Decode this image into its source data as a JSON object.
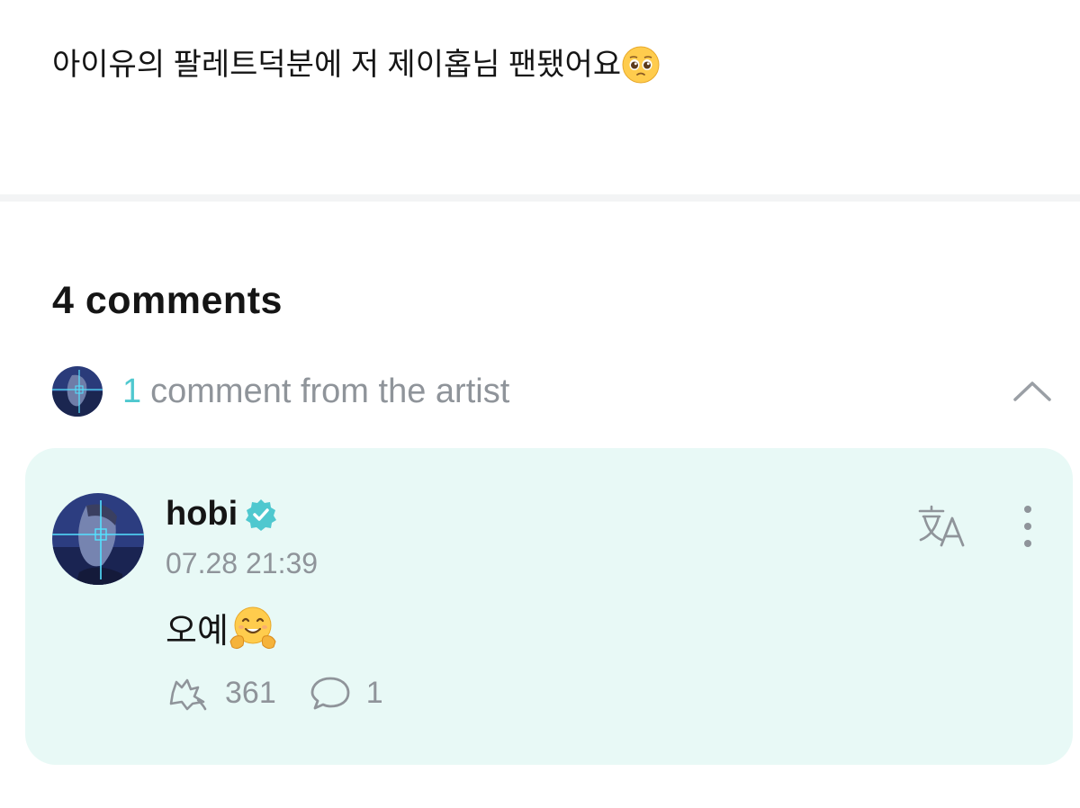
{
  "post": {
    "text": "아이유의 팔레트덕분에 저 제이홉님 팬됐어요",
    "emoji_icon": "pleading-face-emoji"
  },
  "comments": {
    "title": "4 comments",
    "artist_summary": {
      "count": "1",
      "label": "comment from the artist",
      "collapse_icon": "chevron-up-icon"
    },
    "items": [
      {
        "author": "hobi",
        "verified_icon": "verified-badge-icon",
        "timestamp": "07.28 21:39",
        "text": "오예",
        "emoji_icon": "hugging-face-emoji",
        "likes": "361",
        "replies": "1",
        "like_icon": "cheer-icon",
        "reply_icon": "comment-bubble-icon",
        "translate_icon": "translate-icon",
        "more_icon": "more-vertical-icon"
      }
    ]
  },
  "colors": {
    "accent": "#4fc8cf",
    "card_background": "#e8f9f6",
    "muted_text": "#8f949a",
    "primary_text": "#151515"
  }
}
